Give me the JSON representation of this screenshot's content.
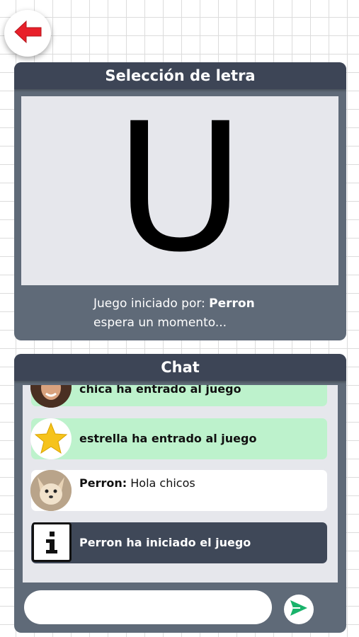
{
  "header": {
    "back_icon": "back-arrow-icon",
    "accent_color": "#e8202a"
  },
  "letter_selection": {
    "title": "Selección de letra",
    "letter": "U",
    "started_label": "Juego iniciado por: ",
    "started_by": "Perron",
    "wait_text": "espera un momento..."
  },
  "chat": {
    "title": "Chat",
    "messages": [
      {
        "type": "join",
        "avatar": "girl-avatar",
        "text": "chica ha entrado al juego"
      },
      {
        "type": "join",
        "avatar": "star-avatar",
        "text": "estrella ha entrado al juego"
      },
      {
        "type": "chat",
        "avatar": "dog-avatar",
        "user": "Perron",
        "separator": ":",
        "text": " Hola chicos"
      },
      {
        "type": "system",
        "avatar": "info-icon",
        "text": "Perron ha iniciado el juego"
      }
    ],
    "input_value": "",
    "send_icon": "send-icon"
  },
  "colors": {
    "panel_bg": "#5f6a78",
    "panel_header": "#3d4556",
    "join_bg": "#bdf2cc",
    "send_green": "#19b36b"
  }
}
